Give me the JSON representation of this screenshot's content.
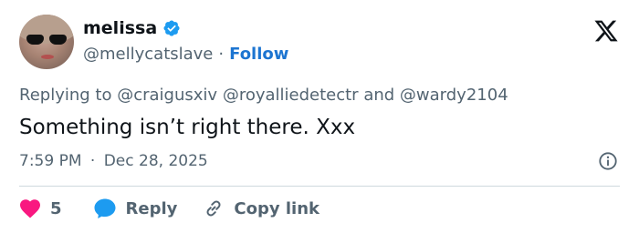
{
  "user": {
    "name": "melissa",
    "handle": "@mellycatslave",
    "separator": "·",
    "follow_label": "Follow",
    "verified": true
  },
  "tweet": {
    "replying_prefix": "Replying to",
    "mentions": [
      "@craigusxiv",
      "@royalliedetectr",
      "@wardy2104"
    ],
    "and_word": "and",
    "text": "Something isn’t right there. Xxx",
    "time": "7:59 PM",
    "date": "Dec 28, 2025"
  },
  "actions": {
    "like_count": "5",
    "reply_label": "Reply",
    "copy_link_label": "Copy link"
  },
  "icons": {
    "brand": "x-logo-icon",
    "verified": "verified-badge-icon",
    "like": "heart-icon",
    "reply": "speech-bubble-icon",
    "copy": "link-icon",
    "info": "info-icon"
  },
  "colors": {
    "text": "#0f1419",
    "secondary": "#536471",
    "accent": "#1d75d1",
    "heart": "#f91880",
    "reply_bubble": "#1d9bf0",
    "divider": "#cfd9de"
  }
}
